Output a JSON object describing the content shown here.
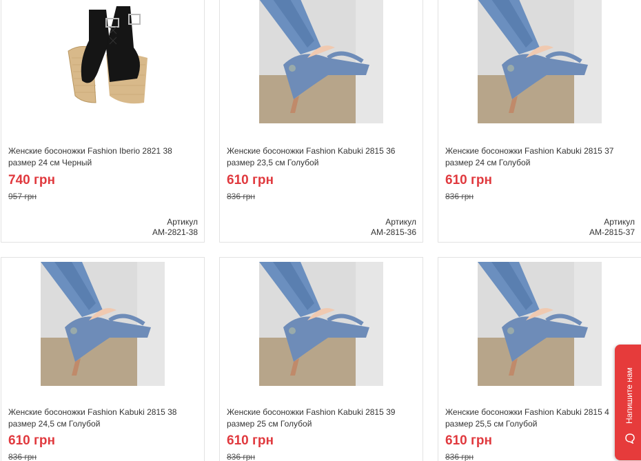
{
  "colors": {
    "price": "#e0393e",
    "chat_tab": "#e63b3b",
    "border": "#e2e2e2"
  },
  "products": [
    {
      "title": "Женские босоножки Fashion Iberio 2821 38 размер 24 см Черный",
      "price": "740 грн",
      "old_price": "957 грн",
      "sku_label": "Артикул",
      "sku": "AM-2821-38",
      "image": "black-wedge-sandal"
    },
    {
      "title": "Женские босоножки Fashion Kabuki 2815 36 размер 23,5 см Голубой",
      "price": "610 грн",
      "old_price": "836 грн",
      "sku_label": "Артикул",
      "sku": "AM-2815-36",
      "image": "blue-heel-sandal"
    },
    {
      "title": "Женские босоножки Fashion Kabuki 2815 37 размер 24 см Голубой",
      "price": "610 грн",
      "old_price": "836 грн",
      "sku_label": "Артикул",
      "sku": "AM-2815-37",
      "image": "blue-heel-sandal"
    },
    {
      "title": "Женские босоножки Fashion Kabuki 2815 38 размер 24,5 см Голубой",
      "price": "610 грн",
      "old_price": "836 грн",
      "image": "blue-heel-sandal"
    },
    {
      "title": "Женские босоножки Fashion Kabuki 2815 39 размер 25 см Голубой",
      "price": "610 грн",
      "old_price": "836 грн",
      "image": "blue-heel-sandal"
    },
    {
      "title": "Женские босоножки Fashion Kabuki 2815 4 размер 25,5 см Голубой",
      "price": "610 грн",
      "old_price": "836 грн",
      "image": "blue-heel-sandal"
    }
  ],
  "chat": {
    "label": "Напишите нам",
    "icon": "chat-bubble-icon"
  }
}
